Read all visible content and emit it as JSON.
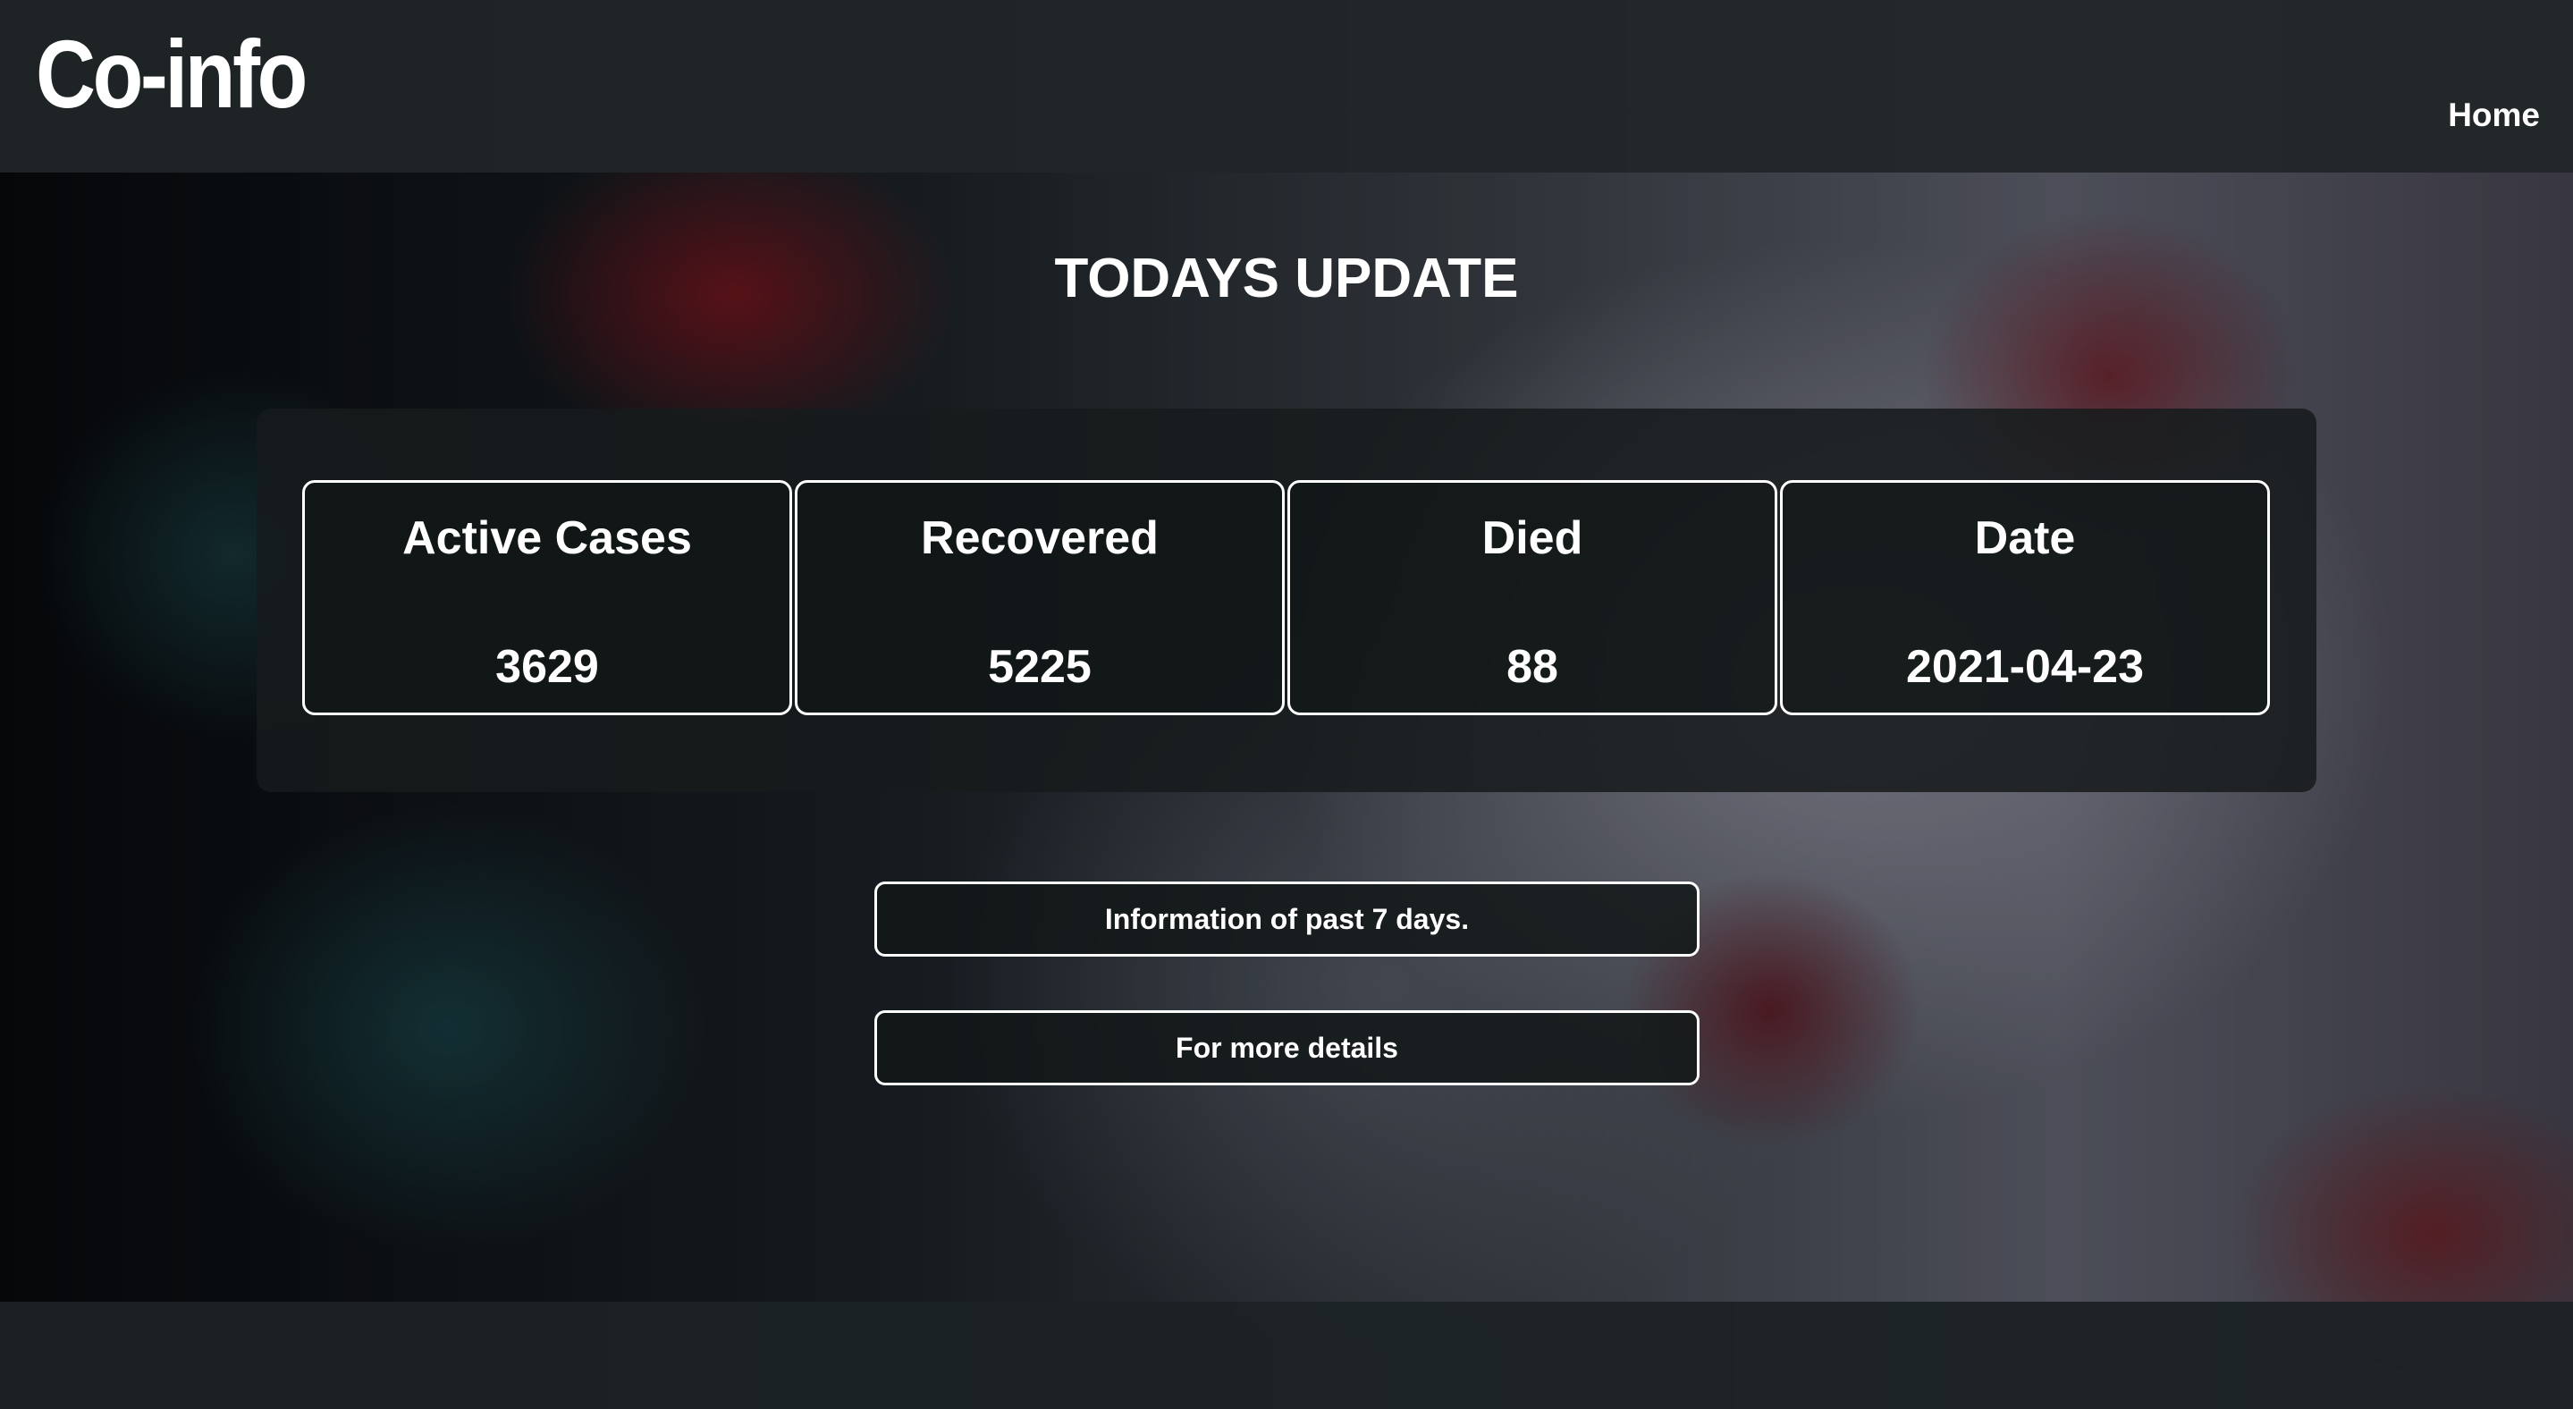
{
  "header": {
    "logo": "Co-info",
    "nav": {
      "home_label": "Home"
    }
  },
  "main": {
    "title": "TODAYS UPDATE",
    "stats": [
      {
        "label": "Active Cases",
        "value": "3629"
      },
      {
        "label": "Recovered",
        "value": "5225"
      },
      {
        "label": "Died",
        "value": "88"
      },
      {
        "label": "Date",
        "value": "2021-04-23"
      }
    ],
    "buttons": {
      "past_7_days": "Information of past 7 days.",
      "more_details": "For more details"
    }
  },
  "colors": {
    "text": "#ffffff",
    "header_bg": "#202628",
    "panel_bg": "#161b1c",
    "card_border": "#ffffff"
  }
}
